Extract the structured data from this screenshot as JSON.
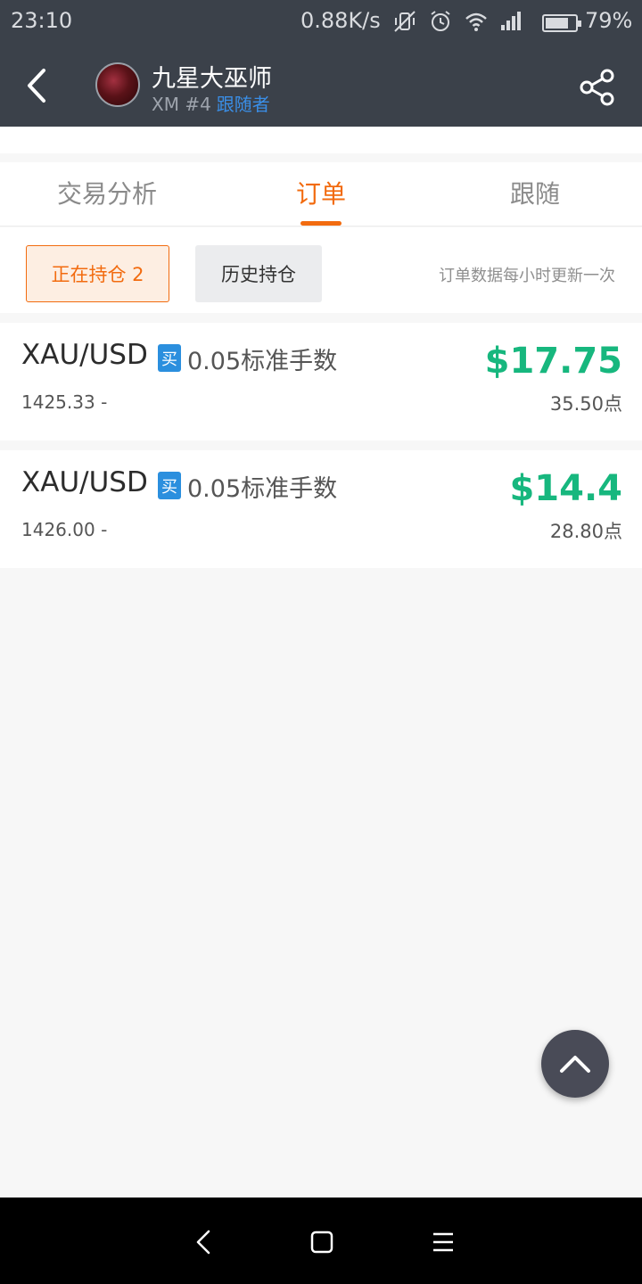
{
  "status_bar": {
    "time": "23:10",
    "net_speed": "0.88K/s",
    "icons": [
      "vibrate-off-icon",
      "alarm-icon",
      "wifi-icon",
      "signal-icon"
    ],
    "battery_level": 0.79,
    "battery_text": "79%"
  },
  "header": {
    "user_name": "九星大巫师",
    "broker_rank": "XM #4",
    "role": "跟随者"
  },
  "tabs": [
    {
      "label": "交易分析",
      "active": false
    },
    {
      "label": "订单",
      "active": true
    },
    {
      "label": "跟随",
      "active": false
    }
  ],
  "filters": {
    "open_positions": "正在持仓 2",
    "history_positions": "历史持仓",
    "update_note": "订单数据每小时更新一次"
  },
  "orders": [
    {
      "symbol": "XAU/USD",
      "side": "买",
      "lots": "0.05标准手数",
      "open": "1425.33 -",
      "profit": "$17.75",
      "points": "35.50点"
    },
    {
      "symbol": "XAU/USD",
      "side": "买",
      "lots": "0.05标准手数",
      "open": "1426.00 -",
      "profit": "$14.4",
      "points": "28.80点"
    }
  ],
  "colors": {
    "header_bg": "#3b414a",
    "accent": "#f26b0f",
    "profit": "#17b77e",
    "buy_badge": "#2b8fde",
    "role_link": "#3a8ee6"
  }
}
